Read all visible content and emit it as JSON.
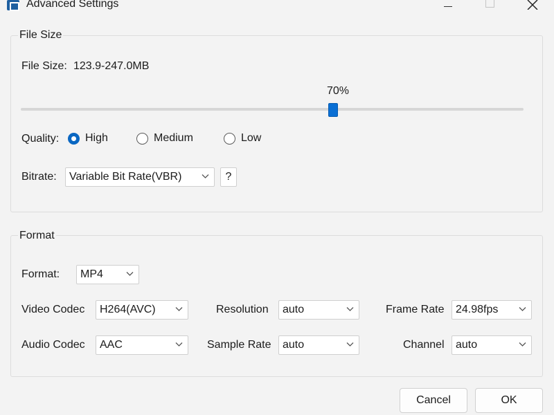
{
  "window": {
    "title": "Advanced Settings"
  },
  "file_size_group": {
    "title": "File Size",
    "file_size_label": "File Size:",
    "file_size_value": "123.9-247.0MB",
    "slider": {
      "value_label": "70%",
      "value_percent": 70
    },
    "quality": {
      "label": "Quality:",
      "options": [
        "High",
        "Medium",
        "Low"
      ],
      "selected": "High"
    },
    "bitrate": {
      "label": "Bitrate:",
      "value": "Variable Bit Rate(VBR)",
      "help_label": "?"
    }
  },
  "format_group": {
    "title": "Format",
    "format": {
      "label": "Format:",
      "value": "MP4"
    },
    "video_codec": {
      "label": "Video Codec",
      "value": "H264(AVC)"
    },
    "audio_codec": {
      "label": "Audio Codec",
      "value": "AAC"
    },
    "resolution": {
      "label": "Resolution",
      "value": "auto"
    },
    "sample_rate": {
      "label": "Sample Rate",
      "value": "auto"
    },
    "frame_rate": {
      "label": "Frame Rate",
      "value": "24.98fps"
    },
    "channel": {
      "label": "Channel",
      "value": "auto"
    }
  },
  "buttons": {
    "cancel": "Cancel",
    "ok": "OK"
  },
  "icons": {
    "app": "app-icon",
    "minimize": "minimize-icon",
    "maximize": "maximize-icon",
    "close": "close-icon",
    "dropdown": "chevron-down-icon"
  },
  "colors": {
    "accent": "#0a67c2",
    "background": "#f3f3f3"
  }
}
